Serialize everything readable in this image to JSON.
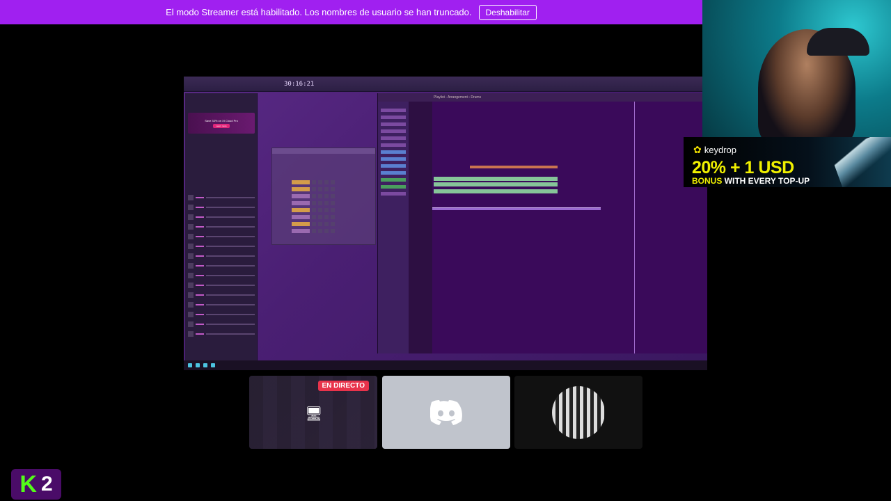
{
  "banner": {
    "message": "El modo Streamer está habilitado. Los nombres de usuario se han truncado.",
    "button_label": "Deshabilitar"
  },
  "screen_share": {
    "fl_time": "30:16:21",
    "playlist_title": "Playlist - Arrangement › Drums",
    "browser_ad_title": "Save 33% on XI Cloud Pro",
    "browser_ad_button": "Learn more"
  },
  "promo": {
    "logo_text": "keydrop",
    "headline": "20% + 1 USD",
    "bonus_word": "BONUS",
    "bonus_rest": " WITH EVERY TOP-UP"
  },
  "tiles": {
    "live_badge": "EN DIRECTO"
  },
  "logo": {
    "letter": "K",
    "number": "2"
  },
  "colors": {
    "banner": "#a020f0",
    "live": "#e8334b",
    "kick_green": "#53fc18"
  }
}
